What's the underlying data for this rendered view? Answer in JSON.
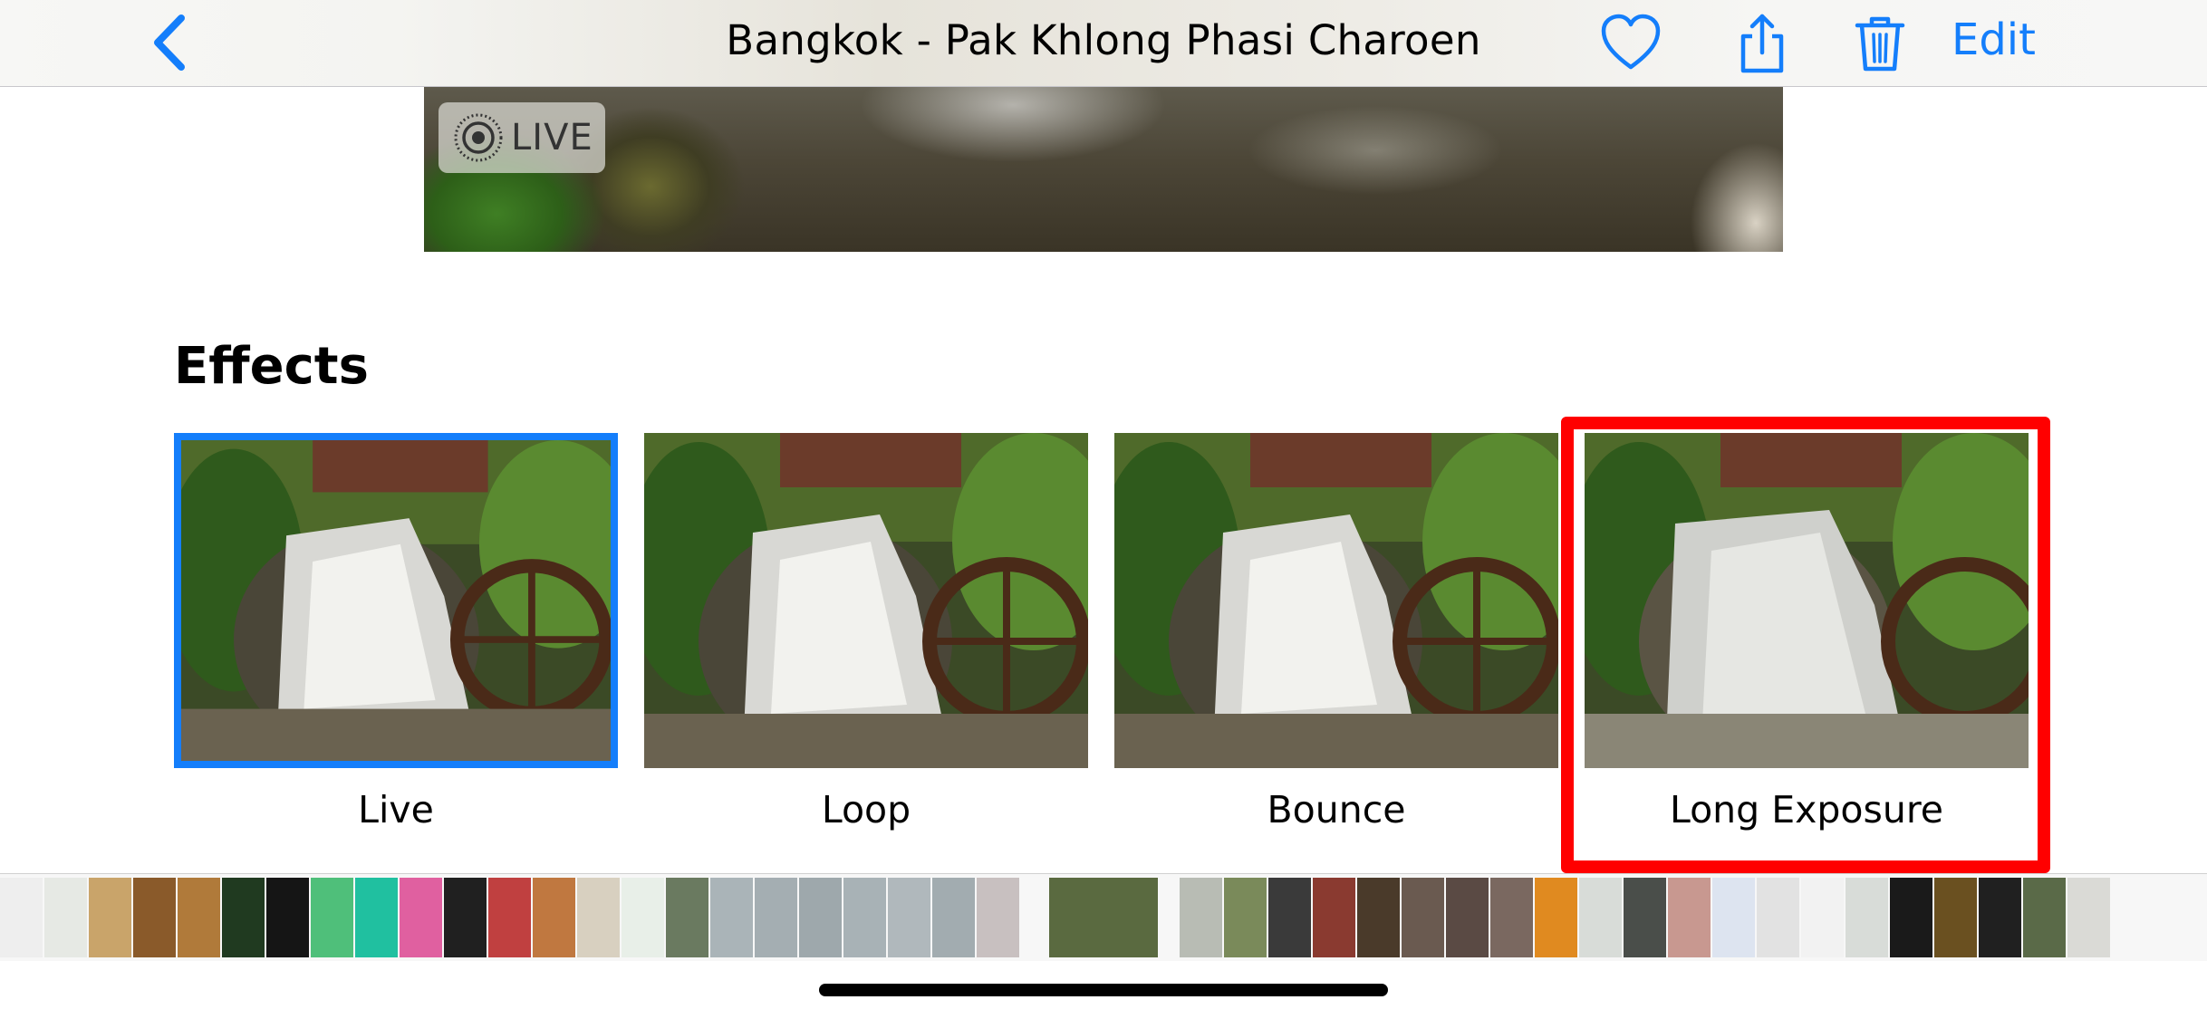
{
  "navbar": {
    "title": "Bangkok - Pak Khlong Phasi Charoen",
    "edit_label": "Edit",
    "back_icon": "chevron-left-icon",
    "favorite_icon": "heart-icon",
    "share_icon": "share-icon",
    "delete_icon": "trash-icon",
    "accent_color": "#147EFB"
  },
  "photo": {
    "live_badge": "LIVE"
  },
  "effects": {
    "heading": "Effects",
    "items": [
      {
        "label": "Live",
        "selected": true
      },
      {
        "label": "Loop",
        "selected": false
      },
      {
        "label": "Bounce",
        "selected": false
      },
      {
        "label": "Long Exposure",
        "selected": false,
        "highlighted": true
      }
    ],
    "selection_color": "#147EFB",
    "highlight_color": "#FF0000"
  }
}
